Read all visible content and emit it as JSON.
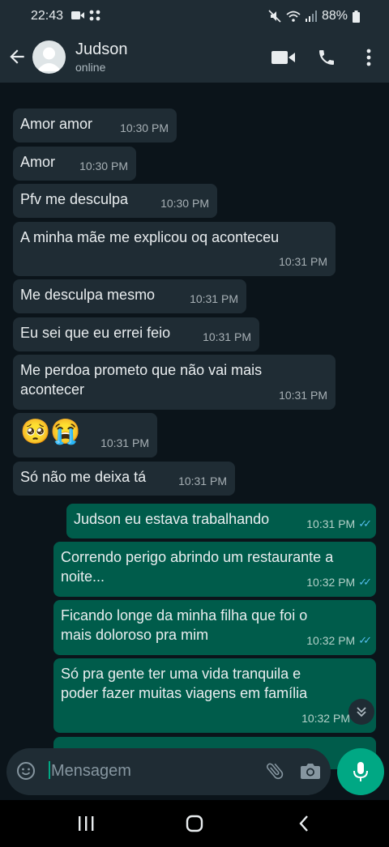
{
  "status_bar": {
    "time": "22:43",
    "battery": "88%"
  },
  "header": {
    "contact_name": "Judson",
    "contact_status": "online"
  },
  "messages": [
    {
      "direction": "in",
      "text": "Amor amor",
      "time": "10:30 PM"
    },
    {
      "direction": "in",
      "text": "Amor",
      "time": "10:30 PM"
    },
    {
      "direction": "in",
      "text": "Pfv me desculpa",
      "time": "10:30 PM"
    },
    {
      "direction": "in",
      "text": "A minha mãe me explicou oq aconteceu",
      "time": "10:31 PM"
    },
    {
      "direction": "in",
      "text": "Me desculpa mesmo",
      "time": "10:31 PM"
    },
    {
      "direction": "in",
      "text": "Eu sei que eu errei feio",
      "time": "10:31 PM"
    },
    {
      "direction": "in",
      "text": "Me perdoa prometo que não vai mais acontecer",
      "time": "10:31 PM"
    },
    {
      "direction": "in",
      "text": "🥺😭",
      "time": "10:31 PM"
    },
    {
      "direction": "in",
      "text": "Só não me deixa tá",
      "time": "10:31 PM"
    },
    {
      "direction": "out",
      "text": "Judson eu estava trabalhando",
      "time": "10:31 PM",
      "read": true
    },
    {
      "direction": "out",
      "text": "Correndo perigo abrindo um restaurante a noite...",
      "time": "10:32 PM",
      "read": true
    },
    {
      "direction": "out",
      "text": "Ficando longe da minha filha que foi o mais doloroso pra mim",
      "time": "10:32 PM",
      "read": true
    },
    {
      "direction": "out",
      "text": "Só pra gente ter uma vida tranquila e poder fazer muitas viagens em família",
      "time": "10:32 PM",
      "read": true
    }
  ],
  "composer": {
    "placeholder": "Mensagem"
  },
  "colors": {
    "accent": "#00a884",
    "incoming_bubble": "#1f2c34",
    "outgoing_bubble": "#005c4b",
    "read_ticks": "#53bdeb"
  },
  "icons": [
    "arrow-back-icon",
    "video-call-icon",
    "phone-icon",
    "more-vert-icon",
    "emoji-icon",
    "attach-icon",
    "camera-icon",
    "mic-icon",
    "scroll-down-icon",
    "recents-icon",
    "home-icon",
    "back-nav-icon"
  ]
}
